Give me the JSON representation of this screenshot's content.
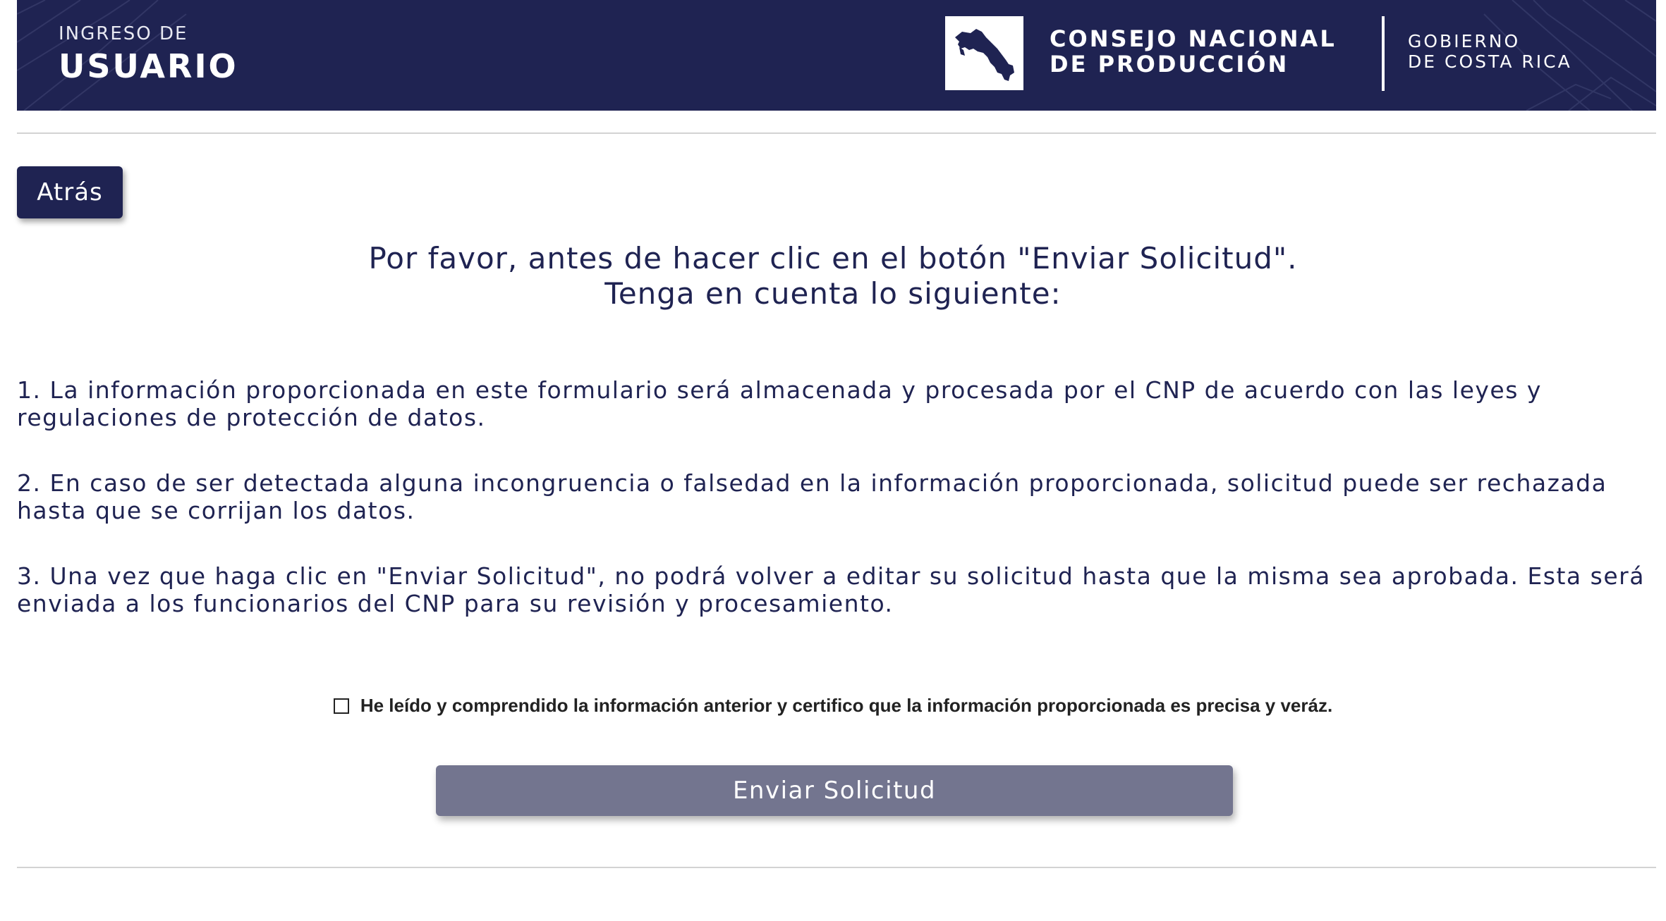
{
  "header": {
    "subtitle": "INGRESO DE",
    "title": "USUARIO",
    "org_line1": "CONSEJO NACIONAL",
    "org_line2": "DE PRODUCCIÓN",
    "gov_line1": "GOBIERNO",
    "gov_line2": "DE COSTA RICA",
    "logo_icon": "costa-rica-map-icon"
  },
  "back_button": {
    "label": "Atrás"
  },
  "instructions": {
    "title_line1": "Por favor, antes de hacer clic en el botón \"Enviar Solicitud\".",
    "title_line2": "Tenga en cuenta lo siguiente:",
    "items": [
      "1. La información proporcionada en este formulario será almacenada y procesada por el CNP de acuerdo con las leyes y regulaciones de protección de datos.",
      "2. En caso de ser detectada alguna incongruencia o falsedad en la información proporcionada, solicitud puede ser rechazada hasta que se corrijan los datos.",
      "3. Una vez que haga clic en \"Enviar Solicitud\", no podrá volver a editar su solicitud hasta que la misma sea aprobada. Esta será enviada a los funcionarios del CNP para su revisión y procesamiento."
    ]
  },
  "confirmation": {
    "checked": false,
    "label": "He leído y comprendido la información anterior y certifico que la información proporcionada es precisa y veráz."
  },
  "submit_button": {
    "label": "Enviar Solicitud"
  },
  "colors": {
    "brand_navy": "#1f2352",
    "submit_gray": "#73758f",
    "divider": "#d3d3d3"
  }
}
